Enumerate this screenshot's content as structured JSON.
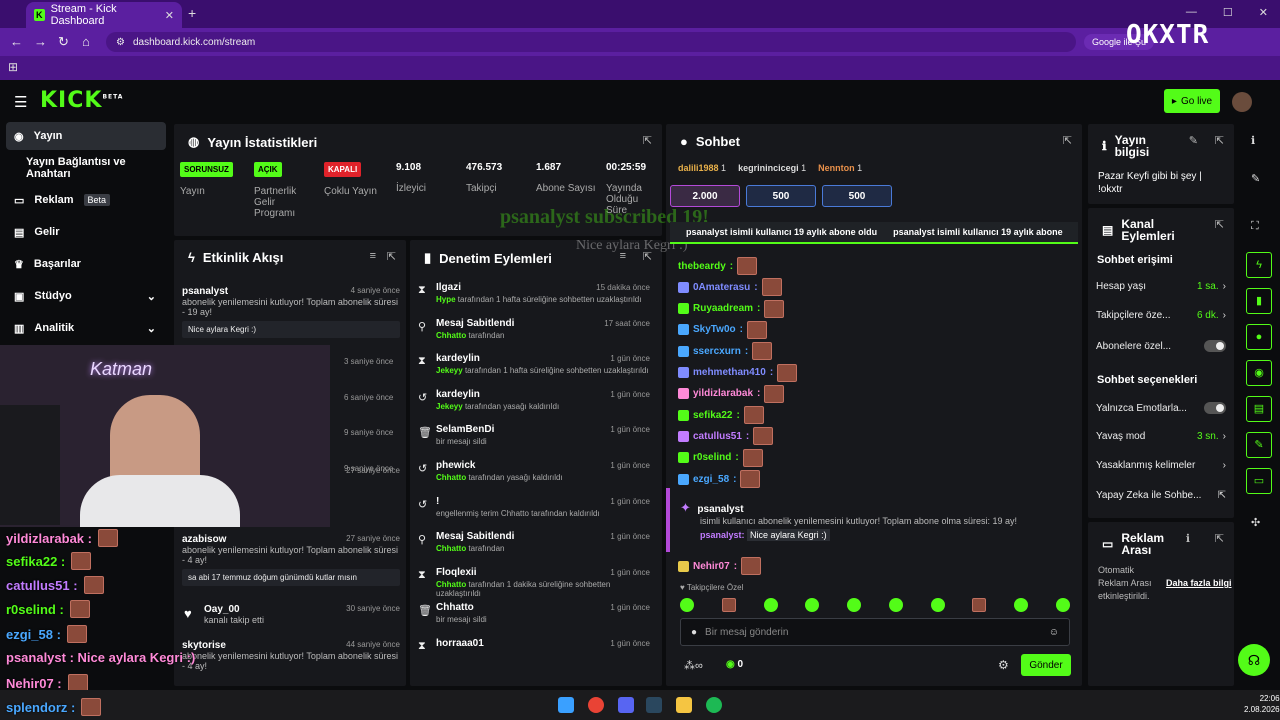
{
  "browser": {
    "tab_title": "Stream - Kick Dashboard",
    "url": "dashboard.kick.com/stream",
    "google_pill": "Google ile Şu",
    "overlay_logo": "OKXTR"
  },
  "header": {
    "logo": "KICK",
    "beta": "BETA",
    "go_live": "Go live"
  },
  "sidebar": {
    "items": [
      {
        "label": "Yayın",
        "active": true
      },
      {
        "label": "Yayın Bağlantısı ve Anahtarı"
      },
      {
        "label": "Reklam",
        "badge": "Beta"
      },
      {
        "label": "Gelir"
      },
      {
        "label": "Başarılar"
      },
      {
        "label": "Stüdyo"
      },
      {
        "label": "Analitik"
      }
    ]
  },
  "stats": {
    "title": "Yayın İstatistikleri",
    "cells": [
      {
        "pill": "SORUNSUZ",
        "label": "Yayın",
        "pill_color": "#53fc18"
      },
      {
        "pill": "AÇIK",
        "label": "Partnerlik Gelir Programı",
        "pill_color": "#53fc18"
      },
      {
        "pill": "KAPALI",
        "label": "Çoklu Yayın",
        "pill_color": "#e0222a"
      },
      {
        "value": "9.108",
        "label": "İzleyici"
      },
      {
        "value": "476.573",
        "label": "Takipçi"
      },
      {
        "value": "1.687",
        "label": "Abone Sayısı"
      },
      {
        "value": "00:25:59",
        "label": "Yayında Olduğu Süre"
      }
    ]
  },
  "activity": {
    "title": "Etkinlik Akışı",
    "items": [
      {
        "name": "psanalyst",
        "time": "4 saniye önce",
        "text": "abonelik yenilemesini kutluyor! Toplam abonelik süresi - 19 ay!",
        "quote": "Nice aylara Kegri :)"
      },
      {
        "time": "3 saniye önce"
      },
      {
        "time": "6 saniye önce"
      },
      {
        "time": "9 saniye önce"
      },
      {
        "time": "9 saniye önce"
      },
      {
        "time": "27 saniye önce"
      },
      {
        "name": "azabisow",
        "time": "27 saniye önce",
        "text": "abonelik yenilemesini kutluyor! Toplam abonelik süresi - 4 ay!",
        "quote": "sa abi 17 temmuz doğum günümdü kutlar mısın"
      },
      {
        "name": "Oay_00",
        "time": "30 saniye önce",
        "text": "kanalı takip etti"
      },
      {
        "name": "skytorise",
        "time": "44 saniye önce",
        "text": "abonelik yenilemesini kutluyor! Toplam abonelik süresi - 4 ay!"
      }
    ]
  },
  "moderation": {
    "title": "Denetim Eylemleri",
    "items": [
      {
        "icon": "⧗",
        "name": "Ilgazi",
        "time": "15 dakika önce",
        "actor": "Hype",
        "text": "tarafından 1 hafta süreliğine sohbetten uzaklaştırıldı"
      },
      {
        "icon": "⚲",
        "name": "Mesaj Sabitlendi",
        "time": "17 saat önce",
        "actor": "Chhatto",
        "text": "tarafından"
      },
      {
        "icon": "⧗",
        "name": "kardeylin",
        "time": "1 gün önce",
        "actor": "Jekeyy",
        "text": "tarafından 1 hafta süreliğine sohbetten uzaklaştırıldı"
      },
      {
        "icon": "↺",
        "name": "kardeylin",
        "time": "1 gün önce",
        "actor": "Jekeyy",
        "text": "tarafından yasağı kaldırıldı"
      },
      {
        "icon": "🗑",
        "name": "SelamBenDi",
        "time": "1 gün önce",
        "actor": "",
        "text": "bir mesajı sildi"
      },
      {
        "icon": "↺",
        "name": "phewick",
        "time": "1 gün önce",
        "actor": "Chhatto",
        "text": "tarafından yasağı kaldırıldı"
      },
      {
        "icon": "↺",
        "name": "!",
        "time": "1 gün önce",
        "actor": "",
        "text": "engellenmiş terim Chhatto tarafından kaldırıldı"
      },
      {
        "icon": "⚲",
        "name": "Mesaj Sabitlendi",
        "time": "1 gün önce",
        "actor": "Chhatto",
        "text": "tarafından"
      },
      {
        "icon": "⧗",
        "name": "Floqlexii",
        "time": "1 gün önce",
        "actor": "Chhatto",
        "text": "tarafından 1 dakika süreliğine sohbetten uzaklaştırıldı"
      },
      {
        "icon": "🗑",
        "name": "Chhatto",
        "time": "1 gün önce",
        "actor": "",
        "text": "bir mesajı sildi"
      },
      {
        "icon": "⧗",
        "name": "horraaa01",
        "time": "1 gün önce",
        "actor": "",
        "text": ""
      }
    ]
  },
  "chat": {
    "title": "Sohbet",
    "top_gifters": [
      {
        "name": "dalili1988",
        "n": "1"
      },
      {
        "name": "kegrinincicegi",
        "n": "1"
      },
      {
        "name": "Nennton",
        "n": "1"
      }
    ],
    "kicks": [
      "2.000",
      "500",
      "500"
    ],
    "banner_left": "psanalyst isimli kullanıcı 19 aylık abone oldu",
    "banner_right": "psanalyst isimli kullanıcı 19 aylık abone",
    "overlay_sub": "psanalyst subscribed 19!",
    "overlay_msg": "Nice aylara Kegri :)",
    "messages": [
      {
        "user": "thebeardy",
        "color": "#53fc18"
      },
      {
        "user": "0Amaterasu",
        "color": "#7f8cff"
      },
      {
        "user": "Ruyaadream",
        "color": "#53fc18"
      },
      {
        "user": "SkyTw0o",
        "color": "#4aa8ff"
      },
      {
        "user": "ssercxurn",
        "color": "#4aa8ff"
      },
      {
        "user": "mehmethan410",
        "color": "#7f8cff"
      },
      {
        "user": "yildizlarabak",
        "color": "#ff8ad8"
      },
      {
        "user": "sefika22",
        "color": "#53fc18"
      },
      {
        "user": "catullus51",
        "color": "#c27cff"
      },
      {
        "user": "r0selind",
        "color": "#53fc18"
      },
      {
        "user": "ezgi_58",
        "color": "#4aa8ff"
      }
    ],
    "sub_event": {
      "user": "psanalyst",
      "text": "isimli kullanıcı abonelik yenilemesini kutluyor! Toplam abone olma süresi: 19 ay!",
      "reply_user": "psanalyst:",
      "reply": "Nice aylara Kegri :)"
    },
    "last_msg": "Nehir07",
    "followers_only": "Takipçilere Özel",
    "input_placeholder": "Bir mesaj gönderin",
    "kicks_count": "0",
    "send": "Gönder"
  },
  "stream_info": {
    "title": "Yayın bilgisi",
    "text": "Pazar Keyfi gibi bi şey | !okxtr"
  },
  "channel_actions": {
    "title": "Kanal Eylemleri",
    "chat_access": "Sohbet erişimi",
    "rows": [
      {
        "label": "Hesap yaşı",
        "value": "1 sa."
      },
      {
        "label": "Takipçilere öze...",
        "value": "6 dk."
      },
      {
        "label": "Abonelere özel..."
      }
    ],
    "chat_options": "Sohbet seçenekleri",
    "rows2": [
      {
        "label": "Yalnızca Emotlarla..."
      },
      {
        "label": "Yavaş mod",
        "value": "3 sn."
      },
      {
        "label": "Yasaklanmış kelimeler"
      },
      {
        "label": "Yapay Zeka ile Sohbe..."
      }
    ]
  },
  "ad_break": {
    "title": "Reklam Arası",
    "text1": "Otomatik Reklam Arası etkinleştirildi.",
    "link": "Daha fazla bilgi"
  },
  "webcam": {
    "neon": "Katman",
    "overlay_chat": [
      {
        "user": "yildizlarabak :",
        "color": "#ff8ad8"
      },
      {
        "user": "sefika22 :",
        "color": "#53fc18"
      },
      {
        "user": "catullus51 :",
        "color": "#c27cff"
      },
      {
        "user": "r0selind :",
        "color": "#53fc18"
      },
      {
        "user": "ezgi_58 :",
        "color": "#4aa8ff"
      },
      {
        "user": "psanalyst : Nice aylara Kegri :)",
        "color": "#ff8ad8"
      },
      {
        "user": "Nehir07 :",
        "color": "#ff8ad8"
      },
      {
        "user": "splendorz :",
        "color": "#4aa8ff"
      }
    ]
  },
  "taskbar": {
    "time": "22:06",
    "date": "2.08.2026"
  }
}
